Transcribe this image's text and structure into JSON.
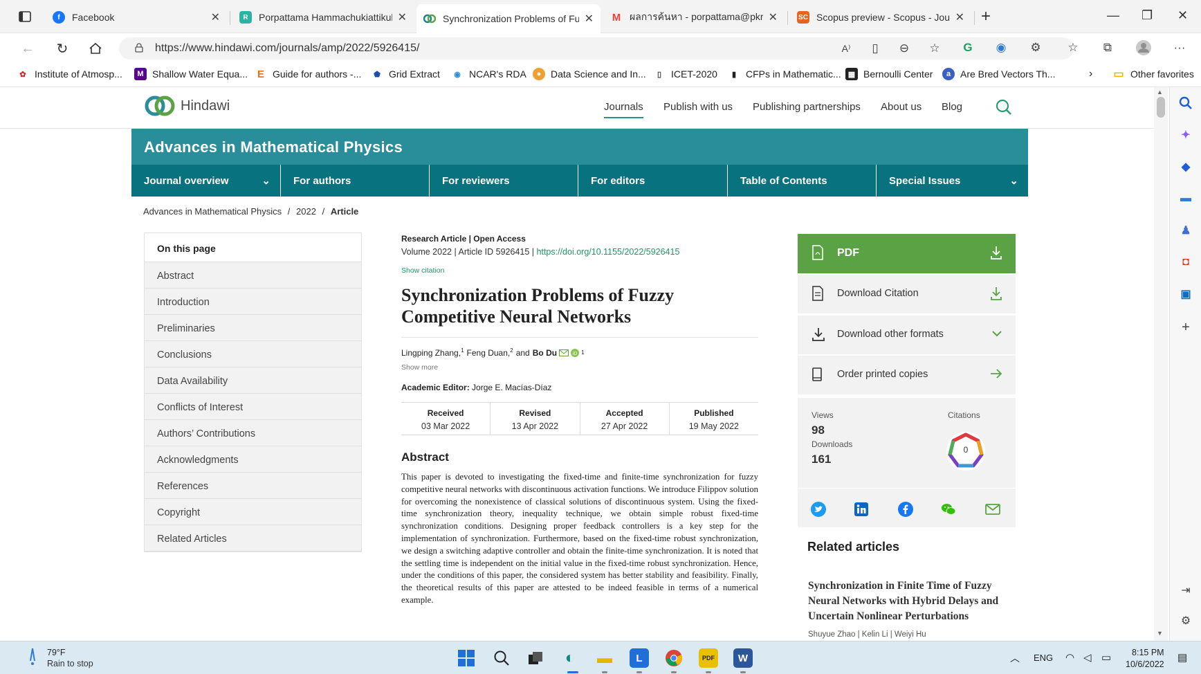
{
  "browser": {
    "tabs": [
      {
        "title": "Facebook",
        "color": "#1877f2"
      },
      {
        "title": "Porpattama Hammachukiattikul |",
        "color": "#2bb3a3"
      },
      {
        "title": "Synchronization Problems of Fuz",
        "color": "#1a7f8c"
      },
      {
        "title": "ผลการค้นหา - porpattama@pkru.",
        "color": "#ea4335"
      },
      {
        "title": "Scopus preview - Scopus - Journ",
        "color": "#e8641b"
      }
    ],
    "url": "https://www.hindawi.com/journals/amp/2022/5926415/",
    "bookmarks": [
      "Institute of Atmosp...",
      "Shallow Water Equa...",
      "Guide for authors -...",
      "Grid Extract",
      "NCAR's RDA",
      "Data Science and In...",
      "ICET-2020",
      "CFPs in Mathematic...",
      "Bernoulli Center",
      "Are Bred Vectors Th..."
    ],
    "other_favorites": "Other favorites"
  },
  "site": {
    "logo": "Hindawi",
    "nav": [
      "Journals",
      "Publish with us",
      "Publishing partnerships",
      "About us",
      "Blog"
    ]
  },
  "journal": {
    "title": "Advances in Mathematical Physics",
    "nav": [
      "Journal overview",
      "For authors",
      "For reviewers",
      "For editors",
      "Table of Contents",
      "Special Issues"
    ]
  },
  "breadcrumb": {
    "journal": "Advances in Mathematical Physics",
    "year": "2022",
    "current": "Article",
    "sep": "/"
  },
  "toc": {
    "heading": "On this page",
    "items": [
      "Abstract",
      "Introduction",
      "Preliminaries",
      "Conclusions",
      "Data Availability",
      "Conflicts of Interest",
      "Authors’ Contributions",
      "Acknowledgments",
      "References",
      "Copyright",
      "Related Articles"
    ]
  },
  "article": {
    "type": "Research Article | Open Access",
    "meta_prefix": "Volume 2022 | Article ID 5926415 |",
    "doi": "https://doi.org/10.1155/2022/5926415",
    "show_citation": "Show citation",
    "title": "Synchronization Problems of Fuzzy Competitive Neural Networks",
    "authors": [
      {
        "name": "Lingping Zhang,",
        "sup": "1"
      },
      {
        "name": "Feng Duan,",
        "sup": "2"
      },
      {
        "name": "and",
        "sup": ""
      },
      {
        "name": "Bo Du",
        "sup": "1"
      }
    ],
    "show_more": "Show more",
    "editor_label": "Academic Editor:",
    "editor": "Jorge E. Macías-Díaz",
    "dates": [
      {
        "label": "Received",
        "value": "03 Mar 2022"
      },
      {
        "label": "Revised",
        "value": "13 Apr 2022"
      },
      {
        "label": "Accepted",
        "value": "27 Apr 2022"
      },
      {
        "label": "Published",
        "value": "19 May 2022"
      }
    ],
    "abstract_heading": "Abstract",
    "abstract": "This paper is devoted to investigating the fixed-time and finite-time synchronization for fuzzy competitive neural networks with discontinuous activation functions. We introduce Filippov solution for overcoming the nonexistence of classical solutions of discontinuous system. Using the fixed-time synchronization theory, inequality technique, we obtain simple robust fixed-time synchronization conditions. Designing proper feedback controllers is a key step for the implementation of synchronization. Furthermore, based on the fixed-time robust synchronization, we design a switching adaptive controller and obtain the finite-time synchronization. It is noted that the settling time is independent on the initial value in the fixed-time robust synchronization. Hence, under the conditions of this paper, the considered system has better stability and feasibility. Finally, the theoretical results of this paper are attested to be indeed feasible in terms of a numerical example."
  },
  "sidebar": {
    "pdf": "PDF",
    "download_citation": "Download Citation",
    "download_other": "Download other formats",
    "order_print": "Order printed copies",
    "views_label": "Views",
    "views": "98",
    "downloads_label": "Downloads",
    "downloads": "161",
    "citations_label": "Citations",
    "citations": "0",
    "related_heading": "Related articles",
    "related_title": "Synchronization in Finite Time of Fuzzy Neural Networks with Hybrid Delays and Uncertain Nonlinear Perturbations",
    "related_authors": "Shuyue Zhao | Kelin Li | Weiyi Hu"
  },
  "taskbar": {
    "temp": "79°F",
    "weather": "Rain to stop",
    "lang": "ENG",
    "time": "8:15 PM",
    "date": "10/6/2022"
  },
  "colors": {
    "teal": "#2a8d9a",
    "teal_dark": "#08727f",
    "green": "#5aa244",
    "link_green": "#1a9a63"
  }
}
